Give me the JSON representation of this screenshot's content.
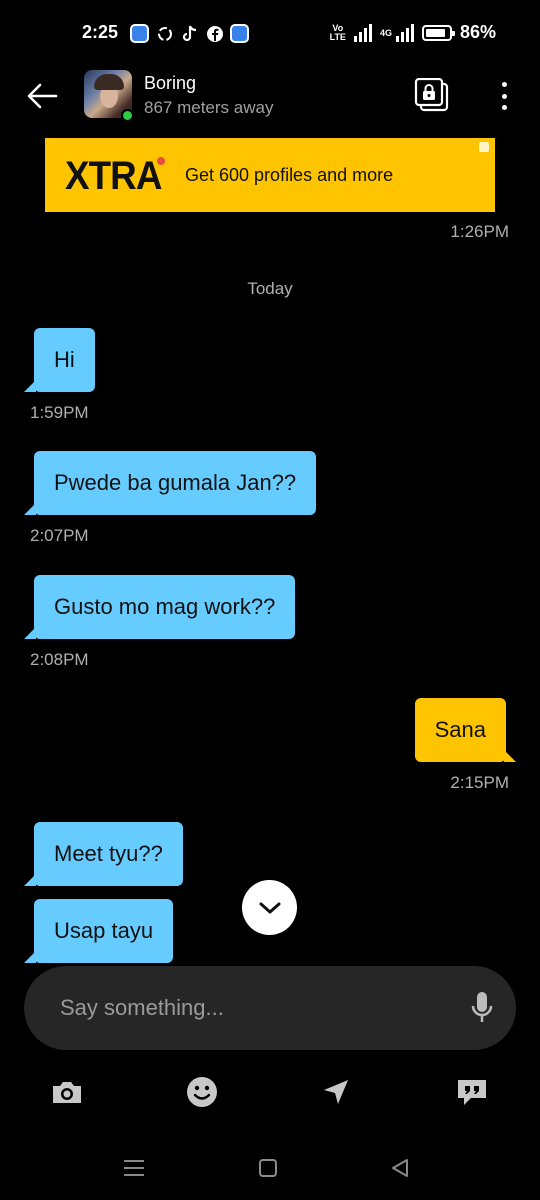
{
  "status_bar": {
    "time": "2:25",
    "volte_line1": "Vo",
    "volte_line2": "LTE",
    "network": "4G",
    "battery": "86%",
    "battery_level": 0.86,
    "app_icons": [
      "app-blue-icon",
      "threads-icon",
      "tiktok-icon",
      "facebook-icon",
      "app-blue-icon"
    ]
  },
  "header": {
    "name": "Boring",
    "distance": "867 meters away",
    "online": true
  },
  "banner": {
    "logo": "XTRA",
    "text": "Get 600 profiles and more",
    "color": "#ffc400"
  },
  "banner_time": "1:26PM",
  "date_separator": "Today",
  "messages": [
    {
      "direction": "in",
      "text": "Hi",
      "time": "1:59PM"
    },
    {
      "direction": "in",
      "text": "Pwede ba gumala Jan??",
      "time": "2:07PM"
    },
    {
      "direction": "in",
      "text": "Gusto mo mag work??",
      "time": "2:08PM"
    },
    {
      "direction": "out",
      "text": "Sana",
      "time": "2:15PM"
    },
    {
      "direction": "in",
      "text": "Meet tyu??"
    },
    {
      "direction": "in",
      "text": "Usap tayu"
    }
  ],
  "colors": {
    "incoming_bubble": "#66ccff",
    "outgoing_bubble": "#ffc400",
    "background": "#000000",
    "input_background": "#262626"
  },
  "composer": {
    "placeholder": "Say something..."
  },
  "toolbar": [
    "camera-icon",
    "emoji-icon",
    "location-icon",
    "saved-phrases-icon"
  ],
  "nav": [
    "recent-apps-icon",
    "home-icon",
    "back-icon"
  ]
}
